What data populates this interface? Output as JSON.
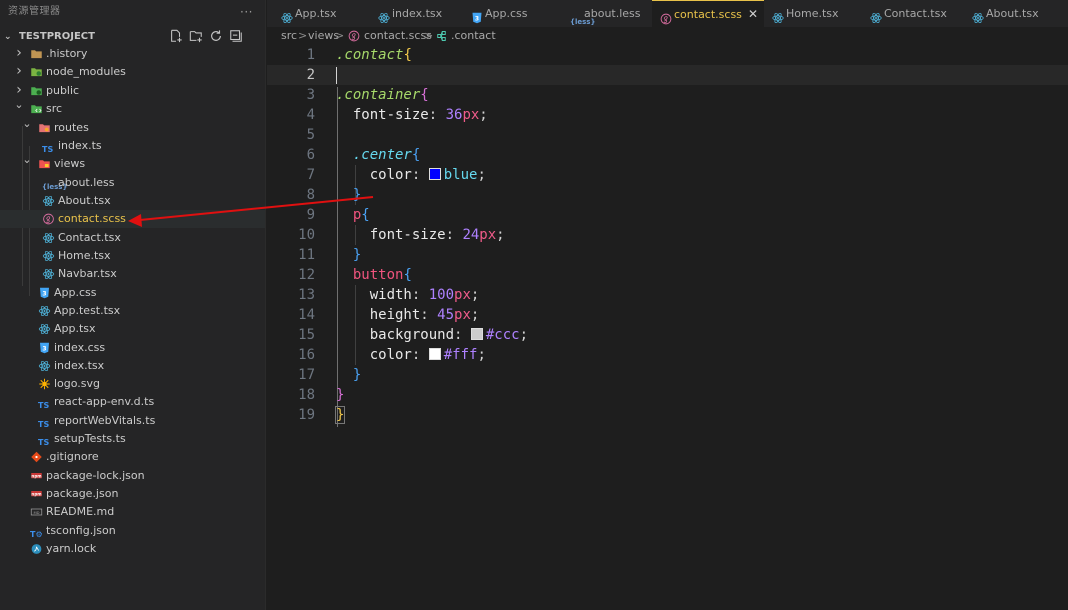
{
  "sidebar": {
    "title": "资源管理器",
    "more": "···",
    "project": "TESTPROJECT",
    "items": [
      {
        "label": ".history",
        "type": "folder",
        "expanded": false,
        "icon": "folder-icon"
      },
      {
        "label": "node_modules",
        "type": "folder",
        "expanded": false,
        "icon": "node-folder-icon"
      },
      {
        "label": "public",
        "type": "folder",
        "expanded": false,
        "icon": "public-folder-icon"
      },
      {
        "label": "src",
        "type": "folder",
        "expanded": true,
        "icon": "src-folder-icon"
      },
      {
        "label": "routes",
        "type": "folder",
        "expanded": true,
        "icon": "routes-folder-icon"
      },
      {
        "label": "index.ts",
        "type": "ts",
        "icon": "ts-icon"
      },
      {
        "label": "views",
        "type": "folder",
        "expanded": true,
        "icon": "views-folder-icon"
      },
      {
        "label": "about.less",
        "type": "less",
        "icon": "less-icon"
      },
      {
        "label": "About.tsx",
        "type": "tsx",
        "icon": "react-icon"
      },
      {
        "label": "contact.scss",
        "type": "scss",
        "icon": "sass-icon"
      },
      {
        "label": "Contact.tsx",
        "type": "tsx",
        "icon": "react-icon"
      },
      {
        "label": "Home.tsx",
        "type": "tsx",
        "icon": "react-icon"
      },
      {
        "label": "Navbar.tsx",
        "type": "tsx",
        "icon": "react-icon"
      },
      {
        "label": "App.css",
        "type": "css",
        "icon": "css-icon"
      },
      {
        "label": "App.test.tsx",
        "type": "tsx",
        "icon": "react-icon"
      },
      {
        "label": "App.tsx",
        "type": "tsx",
        "icon": "react-icon"
      },
      {
        "label": "index.css",
        "type": "css",
        "icon": "css-icon"
      },
      {
        "label": "index.tsx",
        "type": "tsx",
        "icon": "react-icon"
      },
      {
        "label": "logo.svg",
        "type": "svg",
        "icon": "svg-icon"
      },
      {
        "label": "react-app-env.d.ts",
        "type": "ts",
        "icon": "ts-icon"
      },
      {
        "label": "reportWebVitals.ts",
        "type": "ts",
        "icon": "ts-icon"
      },
      {
        "label": "setupTests.ts",
        "type": "ts",
        "icon": "ts-icon"
      },
      {
        "label": ".gitignore",
        "type": "git",
        "icon": "git-icon"
      },
      {
        "label": "package-lock.json",
        "type": "npm",
        "icon": "npm-icon"
      },
      {
        "label": "package.json",
        "type": "npm",
        "icon": "npm-icon"
      },
      {
        "label": "README.md",
        "type": "md",
        "icon": "markdown-icon"
      },
      {
        "label": "tsconfig.json",
        "type": "tsconfig",
        "icon": "tsconfig-icon"
      },
      {
        "label": "yarn.lock",
        "type": "yarn",
        "icon": "yarn-icon"
      }
    ],
    "selected": "contact.scss"
  },
  "tabs": [
    {
      "label": "App.tsx",
      "icon": "react-icon"
    },
    {
      "label": "index.tsx",
      "icon": "react-icon"
    },
    {
      "label": "App.css",
      "icon": "css-icon"
    },
    {
      "label": "about.less",
      "icon": "less-icon"
    },
    {
      "label": "contact.scss",
      "icon": "sass-icon",
      "active": true
    },
    {
      "label": "Home.tsx",
      "icon": "react-icon"
    },
    {
      "label": "Contact.tsx",
      "icon": "react-icon"
    },
    {
      "label": "About.tsx",
      "icon": "react-icon"
    }
  ],
  "tab_close": "✕",
  "breadcrumb": {
    "src": "src",
    "views": "views",
    "file": "contact.scss",
    "symbol": ".contact",
    "sep": ">"
  },
  "editor": {
    "current_line": 2,
    "line_numbers": [
      "1",
      "2",
      "3",
      "4",
      "5",
      "6",
      "7",
      "8",
      "9",
      "10",
      "11",
      "12",
      "13",
      "14",
      "15",
      "16",
      "17",
      "18",
      "19"
    ],
    "code": {
      "l1_sel": ".contact",
      "l3_sel": ".container",
      "l4_prop": "font-size",
      "l4_num": "36",
      "l4_unit": "px",
      "l6_sel": ".center",
      "l7_prop": "color",
      "l7_val": "blue",
      "l9_sel": "p",
      "l10_prop": "font-size",
      "l10_num": "24",
      "l10_unit": "px",
      "l12_sel": "button",
      "l13_prop": "width",
      "l13_num": "100",
      "l13_unit": "px",
      "l14_prop": "height",
      "l14_num": "45",
      "l14_unit": "px",
      "l15_prop": "background",
      "l15_val": "#ccc",
      "l16_prop": "color",
      "l16_val": "#fff"
    },
    "swatches": {
      "blue": "#0000ff",
      "ccc": "#cccccc",
      "fff": "#ffffff"
    }
  },
  "colors": {
    "accent": "#e8c24a",
    "arrow": "#e01010",
    "sidebar_bg": "#252526",
    "editor_bg": "#1e1e1e"
  }
}
